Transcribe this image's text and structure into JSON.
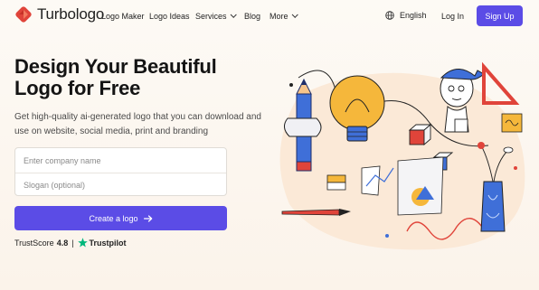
{
  "brand": {
    "name": "Turbologo"
  },
  "nav": {
    "links": [
      {
        "label": "Logo Maker"
      },
      {
        "label": "Logo Ideas"
      },
      {
        "label": "Services"
      },
      {
        "label": "Blog"
      },
      {
        "label": "More"
      }
    ],
    "language": "English",
    "login": "Log In",
    "signup": "Sign Up"
  },
  "hero": {
    "headline_line1": "Design Your Beautiful",
    "headline_line2": "Logo for Free",
    "subtitle": "Get high-quality ai-generated logo that you can download and use on website, social media, print and branding",
    "company_placeholder": "Enter company name",
    "slogan_placeholder": "Slogan (optional)",
    "cta": "Create a logo",
    "trust_label": "TrustScore",
    "trust_score": "4.8",
    "trust_separator": "|",
    "trustpilot": "Trustpilot"
  },
  "colors": {
    "accent": "#5b4ce6",
    "trustpilot_green": "#00b67a",
    "logo_red": "#e0443a"
  },
  "icons": {
    "language": "globe-icon",
    "cta": "arrow-right-icon",
    "trust": "star-icon",
    "dropdown": "chevron-down-icon"
  }
}
